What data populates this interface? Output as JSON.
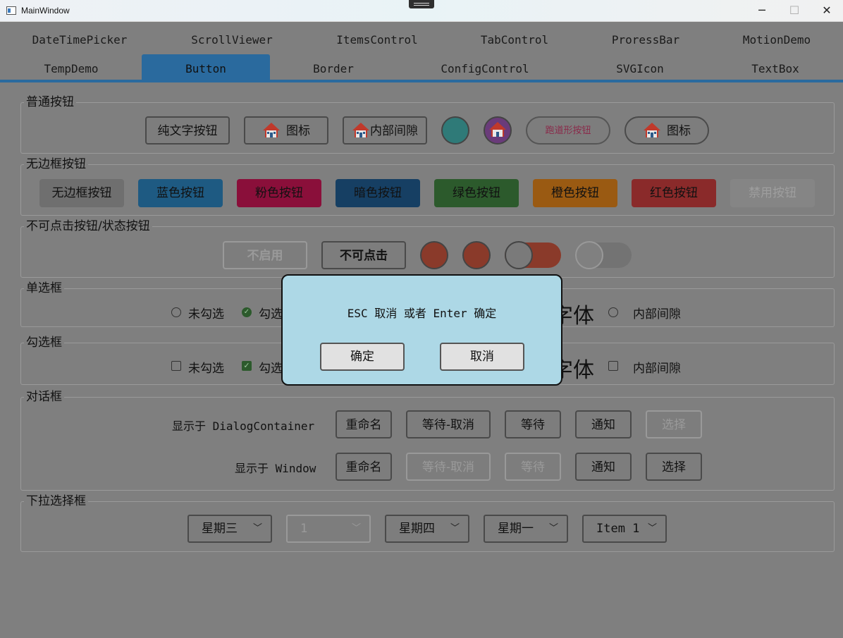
{
  "window": {
    "title": "MainWindow",
    "minimize": "─",
    "maximize": "☐",
    "close": "✕"
  },
  "tabs_row1": [
    "DateTimePicker",
    "ScrollViewer",
    "ItemsControl",
    "TabControl",
    "ProressBar",
    "MotionDemo"
  ],
  "tabs_row2": [
    "TempDemo",
    "Button",
    "Border",
    "ConfigControl",
    "SVGIcon",
    "TextBox"
  ],
  "colors": {
    "accent": "#2a6a9e",
    "dialog_bg": "#add8e6",
    "overlay": "#7f7f7f"
  },
  "groups": {
    "normal": {
      "title": "普通按钮",
      "text_button": "纯文字按钮",
      "icon_button": "图标",
      "padding_button": "内部间隙",
      "pill_button": "跑道形按钮",
      "pill_icon_button": "图标"
    },
    "borderless": {
      "title": "无边框按钮",
      "buttons": [
        "无边框按钮",
        "蓝色按钮",
        "粉色按钮",
        "暗色按钮",
        "绿色按钮",
        "橙色按钮",
        "红色按钮",
        "禁用按钮"
      ]
    },
    "state": {
      "title": "不可点击按钮/状态按钮",
      "disabled": "不启用",
      "unclickable": "不可点击"
    },
    "radio": {
      "title": "单选框",
      "unchecked": "未勾选",
      "checked": "勾选",
      "font": "字体",
      "padding": "内部间隙"
    },
    "checkbox": {
      "title": "勾选框",
      "unchecked": "未勾选",
      "checked": "勾选",
      "font": "字体",
      "padding": "内部间隙"
    },
    "dialogs": {
      "title": "对话框",
      "row1_label": "显示于 DialogContainer",
      "row2_label": "显示于 Window",
      "buttons": [
        "重命名",
        "等待-取消",
        "等待",
        "通知",
        "选择"
      ]
    },
    "combos": {
      "title": "下拉选择框",
      "values": [
        "星期三",
        "1",
        "星期四",
        "星期一",
        "Item 1"
      ]
    }
  },
  "dialog": {
    "message": "ESC 取消 或者 Enter 确定",
    "ok": "确定",
    "cancel": "取消"
  }
}
